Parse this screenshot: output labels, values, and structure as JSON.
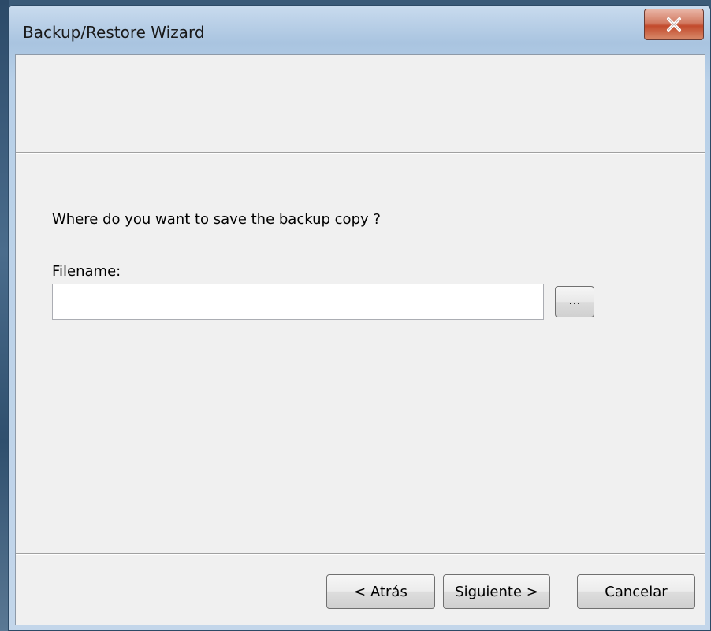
{
  "window": {
    "title": "Backup/Restore Wizard",
    "close_glyph": "x"
  },
  "page": {
    "question": "Where do you want to save the backup copy ?",
    "filename_label": "Filename:",
    "filename_value": "",
    "browse_label": "..."
  },
  "buttons": {
    "back": "< Atrás",
    "next": "Siguiente >",
    "cancel": "Cancelar"
  },
  "colors": {
    "client_bg": "#f0f0f0",
    "title_bar": "#b8d0e8",
    "close_red": "#c24a2c"
  }
}
